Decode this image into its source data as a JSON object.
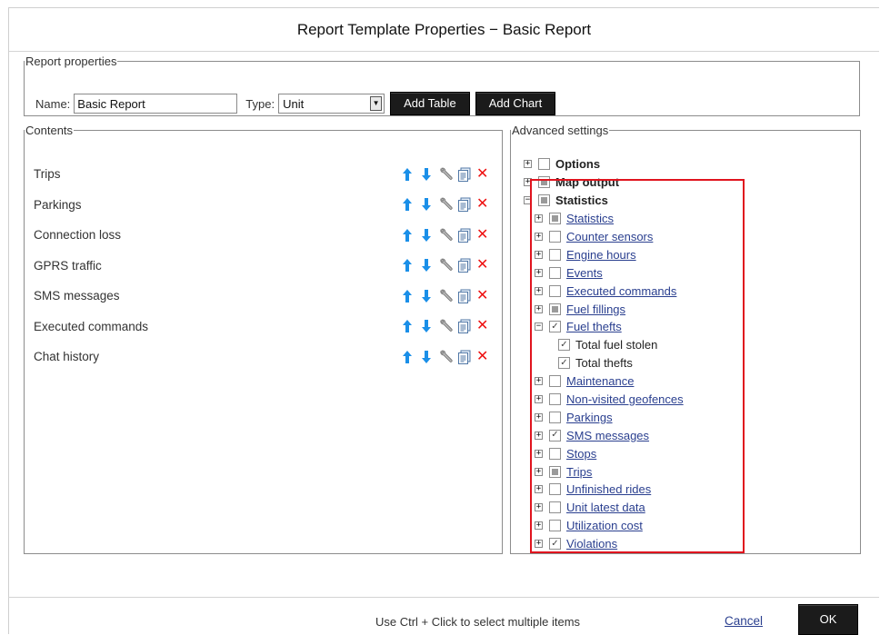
{
  "dialog": {
    "title": "Report Template Properties − Basic Report"
  },
  "report_properties": {
    "legend": "Report properties",
    "name_label": "Name:",
    "name_value": "Basic Report",
    "type_label": "Type:",
    "type_value": "Unit",
    "add_table_label": "Add Table",
    "add_chart_label": "Add Chart"
  },
  "contents": {
    "legend": "Contents",
    "items": [
      {
        "label": "Trips"
      },
      {
        "label": "Parkings"
      },
      {
        "label": "Connection loss"
      },
      {
        "label": "GPRS traffic"
      },
      {
        "label": "SMS messages"
      },
      {
        "label": "Executed commands"
      },
      {
        "label": "Chat history"
      }
    ],
    "action_icons": [
      "arrow-up-icon",
      "arrow-down-icon",
      "wrench-icon",
      "copy-icon",
      "delete-icon"
    ]
  },
  "advanced": {
    "legend": "Advanced settings",
    "tree": [
      {
        "label": "Options",
        "level": 0,
        "expander": "+",
        "check": "none",
        "style": "bold"
      },
      {
        "label": "Map output",
        "level": 0,
        "expander": "+",
        "check": "partial",
        "style": "bold"
      },
      {
        "label": "Statistics",
        "level": 0,
        "expander": "−",
        "check": "partial",
        "style": "bold"
      },
      {
        "label": "Statistics",
        "level": 1,
        "expander": "+",
        "check": "partial",
        "style": "link"
      },
      {
        "label": "Counter sensors",
        "level": 1,
        "expander": "+",
        "check": "none",
        "style": "link"
      },
      {
        "label": "Engine hours",
        "level": 1,
        "expander": "+",
        "check": "none",
        "style": "link"
      },
      {
        "label": "Events",
        "level": 1,
        "expander": "+",
        "check": "none",
        "style": "link"
      },
      {
        "label": "Executed commands",
        "level": 1,
        "expander": "+",
        "check": "none",
        "style": "link"
      },
      {
        "label": "Fuel fillings",
        "level": 1,
        "expander": "+",
        "check": "partial",
        "style": "link"
      },
      {
        "label": "Fuel thefts",
        "level": 1,
        "expander": "−",
        "check": "checked",
        "style": "link"
      },
      {
        "label": "Total fuel stolen",
        "level": 2,
        "expander": "",
        "check": "checked",
        "style": "plain"
      },
      {
        "label": "Total thefts",
        "level": 2,
        "expander": "",
        "check": "checked",
        "style": "plain"
      },
      {
        "label": "Maintenance",
        "level": 1,
        "expander": "+",
        "check": "none",
        "style": "link"
      },
      {
        "label": "Non-visited geofences",
        "level": 1,
        "expander": "+",
        "check": "none",
        "style": "link"
      },
      {
        "label": "Parkings",
        "level": 1,
        "expander": "+",
        "check": "none",
        "style": "link"
      },
      {
        "label": "SMS messages",
        "level": 1,
        "expander": "+",
        "check": "checked",
        "style": "link"
      },
      {
        "label": "Stops",
        "level": 1,
        "expander": "+",
        "check": "none",
        "style": "link"
      },
      {
        "label": "Trips",
        "level": 1,
        "expander": "+",
        "check": "partial",
        "style": "link"
      },
      {
        "label": "Unfinished rides",
        "level": 1,
        "expander": "+",
        "check": "none",
        "style": "link"
      },
      {
        "label": "Unit latest data",
        "level": 1,
        "expander": "+",
        "check": "none",
        "style": "link"
      },
      {
        "label": "Utilization cost",
        "level": 1,
        "expander": "+",
        "check": "none",
        "style": "link"
      },
      {
        "label": "Violations",
        "level": 1,
        "expander": "+",
        "check": "checked",
        "style": "link"
      }
    ],
    "highlight_color": "#e0141e"
  },
  "footer": {
    "hint": "Use Ctrl + Click to select multiple items",
    "cancel_label": "Cancel",
    "ok_label": "OK"
  },
  "colors": {
    "arrow_blue": "#1a8fe8",
    "delete_red": "#e11111",
    "link_blue": "#2a3f8f",
    "button_dark": "#1b1b1b"
  }
}
